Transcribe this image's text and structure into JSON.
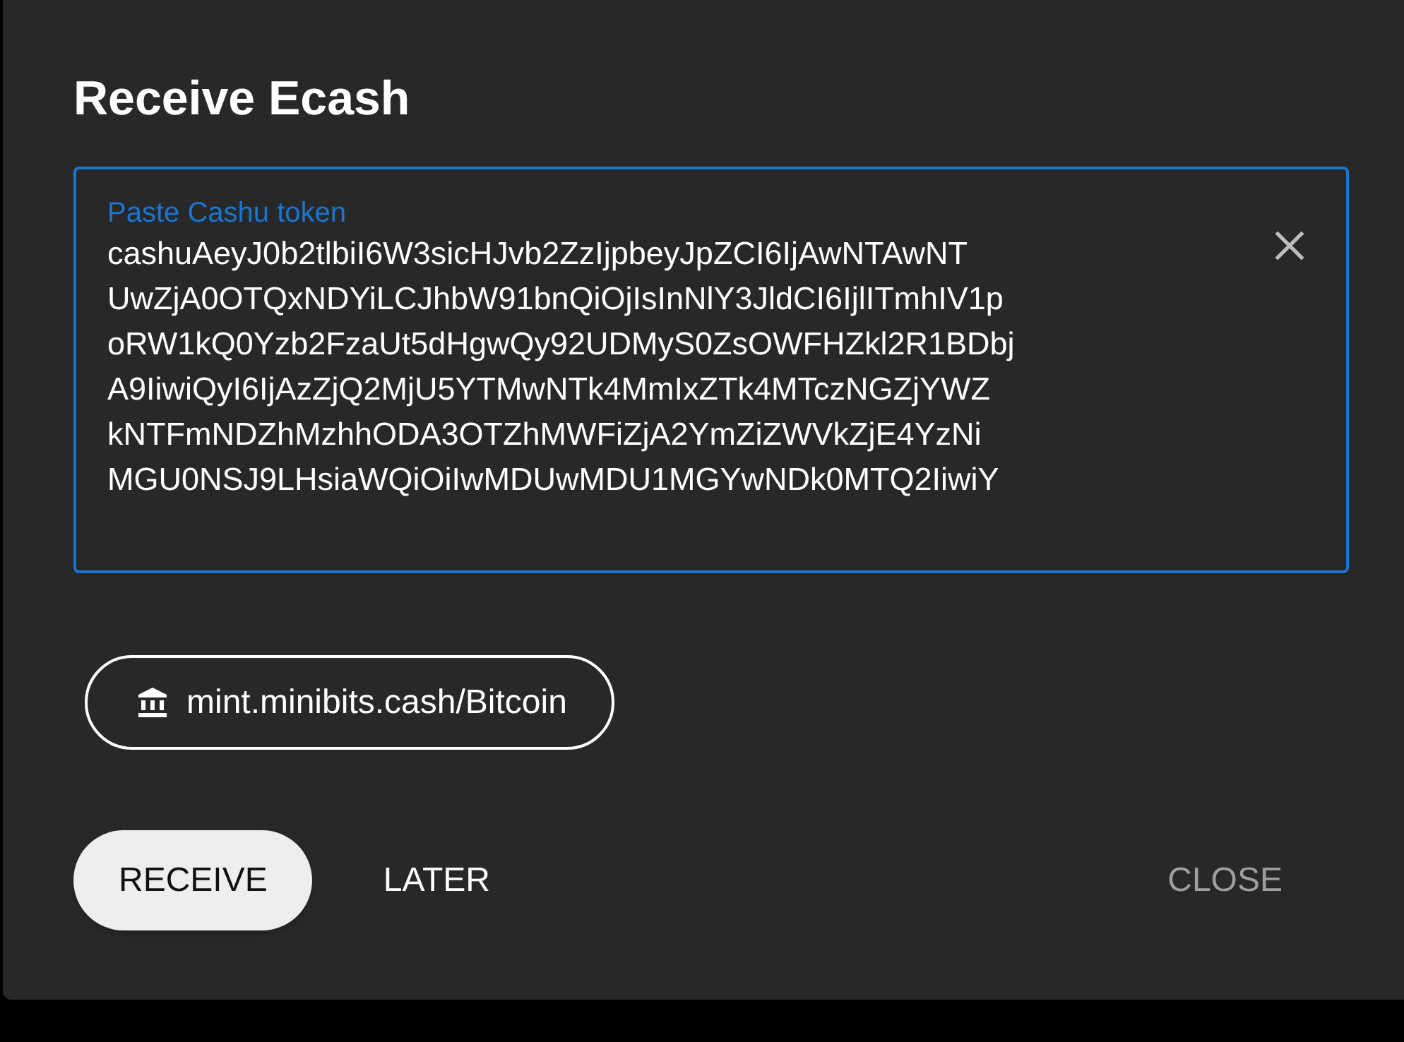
{
  "dialog": {
    "title": "Receive Ecash",
    "token_field": {
      "label": "Paste Cashu token",
      "focused": true,
      "value_lines": [
        "cashuAeyJ0b2tlbiI6W3sicHJvb2ZzIjpbeyJpZCI6IjAwNTAwNT",
        "UwZjA0OTQxNDYiLCJhbW91bnQiOjIsInNlY3JldCI6IjlITmhIV1p",
        "oRW1kQ0Yzb2FzaUt5dHgwQy92UDMyS0ZsOWFHZkl2R1BDbj",
        "A9IiwiQyI6IjAzZjQ2MjU5YTMwNTk4MmIxZTk4MTczNGZjYWZ",
        "kNTFmNDZhMzhhODA3OTZhMWFiZjA2YmZiZWVkZjE4YzNi",
        "MGU0NSJ9LHsiaWQiOiIwMDUwMDU1MGYwNDk0MTQ2IiwiY"
      ]
    },
    "mint_chip": {
      "label": "mint.minibits.cash/Bitcoin"
    },
    "buttons": [
      {
        "label": "RECEIVE",
        "kind": "filled",
        "disabled": false
      },
      {
        "label": "LATER",
        "kind": "text",
        "disabled": false
      },
      {
        "label": "CLOSE",
        "kind": "text",
        "disabled": true
      }
    ]
  }
}
